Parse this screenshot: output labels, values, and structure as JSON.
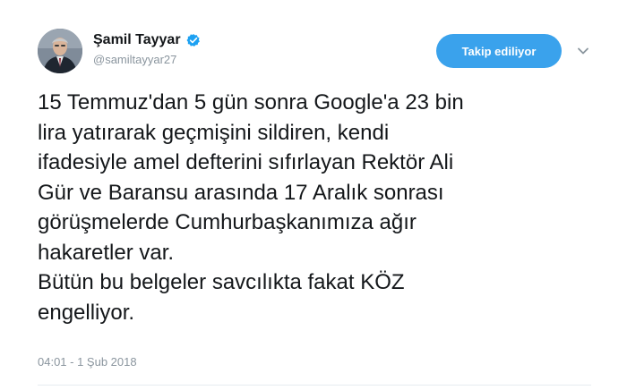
{
  "author": {
    "display_name": "Şamil Tayyar",
    "handle": "@samiltayyar27",
    "verified": true,
    "avatar_icon": "user-photo-avatar"
  },
  "follow_button": {
    "label": "Takip ediliyor",
    "color": "#3aa2ec"
  },
  "menu_icon": "chevron-down-icon",
  "tweet": {
    "text": "15 Temmuz'dan 5 gün sonra Google'a 23 bin\nlira yatırarak geçmişini sildiren, kendi\nifadesiyle amel defterini sıfırlayan Rektör Ali\nGür ve Baransu arasında 17 Aralık sonrası\ngörüşmelerde Cumhurbaşkanımıza ağır\nhakaretler var.\nBütün bu belgeler savcılıkta fakat KÖZ\nengelliyor.",
    "timestamp": "04:01 - 1 Şub 2018"
  },
  "colors": {
    "verified_badge": "#1da1f2",
    "secondary_text": "#8a959e",
    "primary_text": "#14171a"
  }
}
